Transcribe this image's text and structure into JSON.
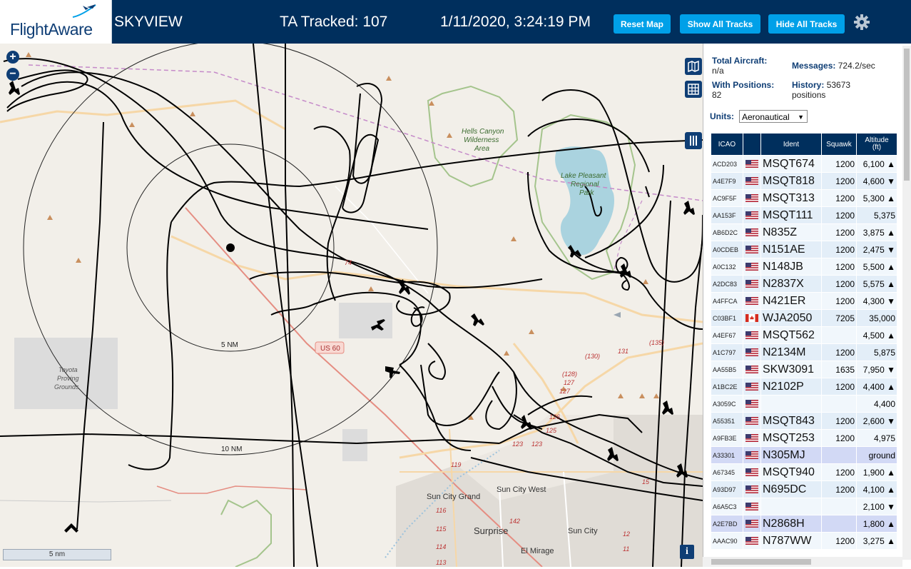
{
  "header": {
    "logo_text": "FlightAware",
    "title": "SKYVIEW",
    "tracked": "TA Tracked: 107",
    "datetime": "1/11/2020, 3:24:19 PM",
    "buttons": {
      "reset": "Reset Map",
      "show": "Show All Tracks",
      "hide": "Hide All Tracks"
    },
    "colors": {
      "bar": "#002f5d",
      "button": "#00a0e8"
    }
  },
  "map": {
    "labels": {
      "ring_inner": "5 NM",
      "ring_outer": "10 NM",
      "hells_canyon": [
        "Hells Canyon",
        "Wilderness",
        "Area"
      ],
      "lake": [
        "Lake Pleasant",
        "Regional",
        "Park"
      ],
      "toyota": [
        "Toyota",
        "Proving",
        "Grounds"
      ],
      "us60": "US 60",
      "sun_city_grand": "Sun City Grand",
      "sun_city_west": "Sun City West",
      "surprise": "Surprise",
      "sun_city": "Sun City",
      "el_mirage": "El Mirage",
      "road_74": "74",
      "road_130": "(130)",
      "road_131": "131",
      "road_135": "(135)",
      "road_128": "(128)",
      "road_127a": "127",
      "road_127b": "127",
      "road_126": "126",
      "road_125": "125",
      "road_123a": "123",
      "road_123b": "123",
      "road_119": "119",
      "road_116": "116",
      "road_115": "115",
      "road_114": "114",
      "road_113": "113",
      "road_142": "142",
      "road_12": "12",
      "road_11": "11",
      "road_15": "15"
    },
    "scale": "5 nm",
    "info": "i",
    "zoom_in": "+",
    "zoom_out": "−"
  },
  "stats": {
    "total_label": "Total Aircraft:",
    "total_value": "n/a",
    "positions_label": "With Positions:",
    "positions_value": "82",
    "messages_label": "Messages:",
    "messages_value": "724.2/sec",
    "history_label": "History:",
    "history_value": "53673",
    "history_unit": "positions"
  },
  "units": {
    "label": "Units:",
    "selected": "Aeronautical"
  },
  "table": {
    "headers": {
      "icao": "ICAO",
      "ident": "Ident",
      "squawk": "Squawk",
      "altitude": "Altitude",
      "altitude_unit": "(ft)"
    },
    "rows": [
      {
        "icao": "ACD203",
        "flag": "us",
        "ident": "MSQT674",
        "squawk": "1200",
        "alt": "6,100 ▲"
      },
      {
        "icao": "A4E7F9",
        "flag": "us",
        "ident": "MSQT818",
        "squawk": "1200",
        "alt": "4,600 ▼"
      },
      {
        "icao": "AC9F5F",
        "flag": "us",
        "ident": "MSQT313",
        "squawk": "1200",
        "alt": "5,300 ▲"
      },
      {
        "icao": "AA153F",
        "flag": "us",
        "ident": "MSQT111",
        "squawk": "1200",
        "alt": "5,375"
      },
      {
        "icao": "AB6D2C",
        "flag": "us",
        "ident": "N835Z",
        "squawk": "1200",
        "alt": "3,875 ▲"
      },
      {
        "icao": "A0CDEB",
        "flag": "us",
        "ident": "N151AE",
        "squawk": "1200",
        "alt": "2,475 ▼"
      },
      {
        "icao": "A0C132",
        "flag": "us",
        "ident": "N148JB",
        "squawk": "1200",
        "alt": "5,500 ▲"
      },
      {
        "icao": "A2DC83",
        "flag": "us",
        "ident": "N2837X",
        "squawk": "1200",
        "alt": "5,575 ▲"
      },
      {
        "icao": "A4FFCA",
        "flag": "us",
        "ident": "N421ER",
        "squawk": "1200",
        "alt": "4,300 ▼"
      },
      {
        "icao": "C03BF1",
        "flag": "ca",
        "ident": "WJA2050",
        "squawk": "7205",
        "alt": "35,000"
      },
      {
        "icao": "A4EF67",
        "flag": "us",
        "ident": "MSQT562",
        "squawk": "",
        "alt": "4,500 ▲"
      },
      {
        "icao": "A1C797",
        "flag": "us",
        "ident": "N2134M",
        "squawk": "1200",
        "alt": "5,875"
      },
      {
        "icao": "AA55B5",
        "flag": "us",
        "ident": "SKW3091",
        "squawk": "1635",
        "alt": "7,950 ▼"
      },
      {
        "icao": "A1BC2E",
        "flag": "us",
        "ident": "N2102P",
        "squawk": "1200",
        "alt": "4,400 ▲"
      },
      {
        "icao": "A3059C",
        "flag": "us",
        "ident": "",
        "squawk": "",
        "alt": "4,400"
      },
      {
        "icao": "A55351",
        "flag": "us",
        "ident": "MSQT843",
        "squawk": "1200",
        "alt": "2,600 ▼"
      },
      {
        "icao": "A9FB3E",
        "flag": "us",
        "ident": "MSQT253",
        "squawk": "1200",
        "alt": "4,975"
      },
      {
        "icao": "A33301",
        "flag": "us",
        "ident": "N305MJ",
        "squawk": "",
        "alt": "ground",
        "selected": true
      },
      {
        "icao": "A67345",
        "flag": "us",
        "ident": "MSQT940",
        "squawk": "1200",
        "alt": "1,900 ▲"
      },
      {
        "icao": "A93D97",
        "flag": "us",
        "ident": "N695DC",
        "squawk": "1200",
        "alt": "4,100 ▲"
      },
      {
        "icao": "A6A5C3",
        "flag": "us",
        "ident": "",
        "squawk": "",
        "alt": "2,100 ▼"
      },
      {
        "icao": "A2E7BD",
        "flag": "us",
        "ident": "N2868H",
        "squawk": "",
        "alt": "1,800 ▲",
        "selected": true
      },
      {
        "icao": "AAAC90",
        "flag": "us",
        "ident": "N787WW",
        "squawk": "1200",
        "alt": "3,275 ▲"
      }
    ]
  }
}
